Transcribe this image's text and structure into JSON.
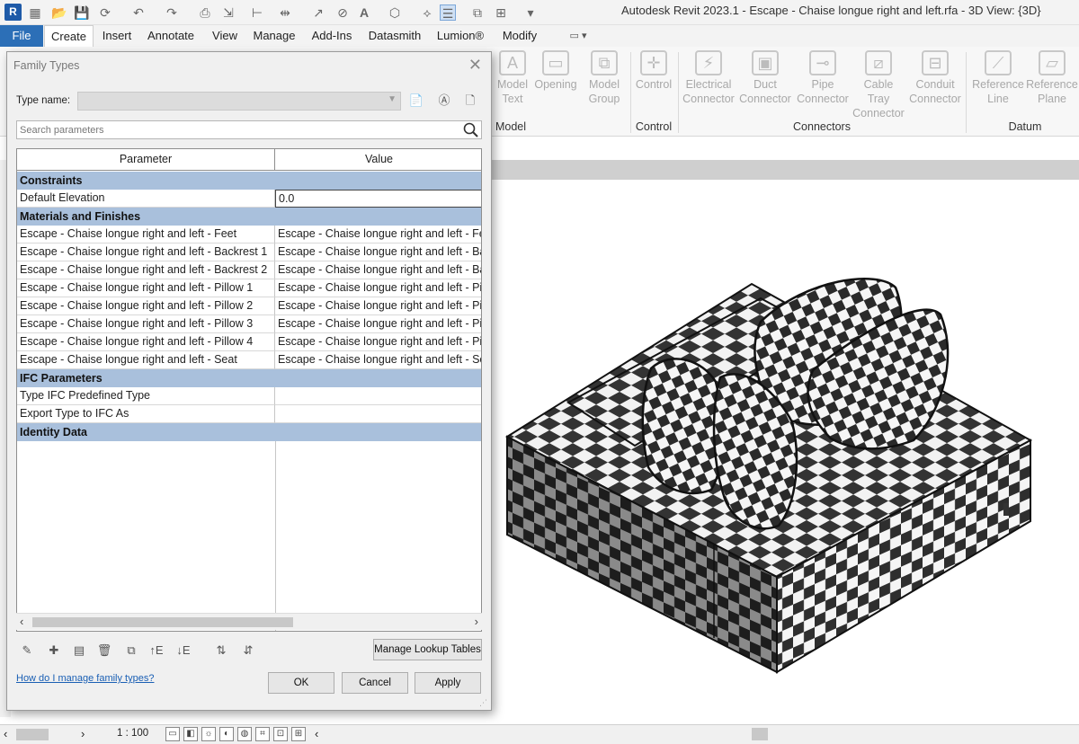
{
  "app": {
    "title": "Autodesk Revit 2023.1 - Escape - Chaise longue right and left.rfa - 3D View: {3D}",
    "logo": "R"
  },
  "ribbon_tabs": [
    "File",
    "Create",
    "Insert",
    "Annotate",
    "View",
    "Manage",
    "Add-Ins",
    "Datasmith",
    "Lumion®",
    "Modify"
  ],
  "ribbon": {
    "buttons": [
      {
        "label": "Model\nText",
        "icon": "model-text-icon"
      },
      {
        "label": "Opening",
        "icon": "opening-icon"
      },
      {
        "label": "Model\nGroup",
        "icon": "model-group-icon"
      },
      {
        "label": "Control",
        "icon": "control-icon"
      },
      {
        "label": "Electrical\nConnector",
        "icon": "electrical-connector-icon"
      },
      {
        "label": "Duct\nConnector",
        "icon": "duct-connector-icon"
      },
      {
        "label": "Pipe\nConnector",
        "icon": "pipe-connector-icon"
      },
      {
        "label": "Cable Tray\nConnector",
        "icon": "cable-tray-connector-icon"
      },
      {
        "label": "Conduit\nConnector",
        "icon": "conduit-connector-icon"
      },
      {
        "label": "Reference\nLine",
        "icon": "reference-line-icon"
      },
      {
        "label": "Reference\nPlane",
        "icon": "reference-plane-icon"
      }
    ],
    "groups": [
      "Model",
      "Control",
      "Connectors",
      "Datum"
    ]
  },
  "dialog": {
    "title": "Family Types",
    "type_name_label": "Type name:",
    "type_name_value": "",
    "search_placeholder": "Search parameters",
    "col_parameter": "Parameter",
    "col_value": "Value",
    "rows": [
      {
        "kind": "group",
        "label": "Constraints"
      },
      {
        "kind": "param",
        "parameter": "Default Elevation",
        "value": "0.0",
        "editable": true
      },
      {
        "kind": "group",
        "label": "Materials and Finishes"
      },
      {
        "kind": "param",
        "parameter": "Escape - Chaise longue right and left - Feet",
        "value": "Escape - Chaise longue right and left - Fe"
      },
      {
        "kind": "param",
        "parameter": "Escape - Chaise longue right and left - Backrest 1",
        "value": "Escape - Chaise longue right and left - Ba"
      },
      {
        "kind": "param",
        "parameter": "Escape - Chaise longue right and left - Backrest 2",
        "value": "Escape - Chaise longue right and left - Ba"
      },
      {
        "kind": "param",
        "parameter": "Escape - Chaise longue right and left - Pillow 1",
        "value": "Escape - Chaise longue right and left - Pil"
      },
      {
        "kind": "param",
        "parameter": "Escape - Chaise longue right and left - Pillow 2",
        "value": "Escape - Chaise longue right and left - Pil"
      },
      {
        "kind": "param",
        "parameter": "Escape - Chaise longue right and left -  Pillow 3",
        "value": "Escape - Chaise longue right and left - Pil"
      },
      {
        "kind": "param",
        "parameter": "Escape - Chaise longue right and left - Pillow 4",
        "value": "Escape - Chaise longue right and left - Pil"
      },
      {
        "kind": "param",
        "parameter": "Escape - Chaise longue right and left - Seat",
        "value": "Escape - Chaise longue right and left - Se"
      },
      {
        "kind": "group",
        "label": "IFC Parameters"
      },
      {
        "kind": "param",
        "parameter": "Type IFC Predefined Type",
        "value": ""
      },
      {
        "kind": "param",
        "parameter": "Export Type to IFC As",
        "value": ""
      },
      {
        "kind": "group",
        "label": "Identity Data"
      }
    ],
    "manage_lookup_label": "Manage Lookup Tables",
    "help_link": "How do I manage family types?",
    "ok_label": "OK",
    "cancel_label": "Cancel",
    "apply_label": "Apply"
  },
  "status": {
    "scale": "1 : 100"
  }
}
